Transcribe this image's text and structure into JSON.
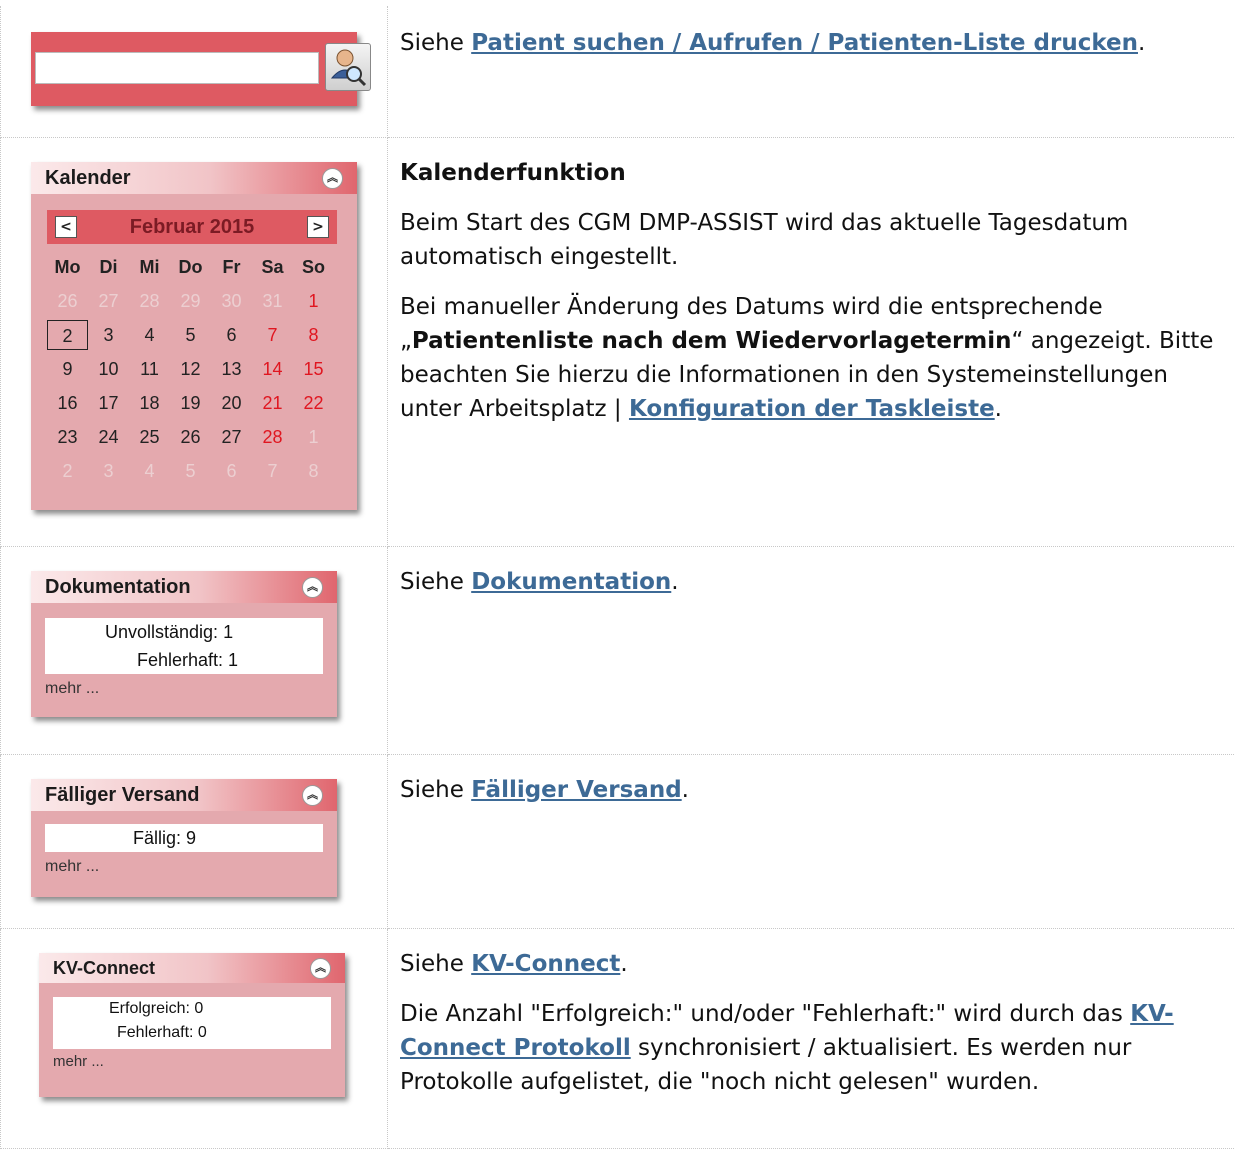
{
  "rows": [
    {
      "widget": "search",
      "icon": "user-search-icon",
      "text": {
        "prefix": "Siehe ",
        "link": "Patient suchen / Aufrufen / Patienten-Liste drucken",
        "suffix": "."
      }
    },
    {
      "widget": "calendar",
      "title": "Kalenderfunktion",
      "para1": "Beim Start des CGM DMP-ASSIST wird das aktuelle Tagesdatum automatisch eingestellt.",
      "para2_a": "Bei manueller Änderung des Datums wird die entsprechende „",
      "para2_bold": "Patientenliste nach dem Wiedervorlagetermin",
      "para2_b": "“ angezeigt. Bitte beachten Sie hierzu die Informationen in den Systemeinstellungen unter Arbeitsplatz | ",
      "para2_link": "Konfiguration der Taskleiste",
      "para2_end": "."
    },
    {
      "widget": "dokumentation",
      "text": {
        "prefix": "Siehe ",
        "link": "Dokumentation",
        "suffix": "."
      }
    },
    {
      "widget": "versand",
      "text": {
        "prefix": "Siehe ",
        "link": "Fälliger Versand",
        "suffix": "."
      }
    },
    {
      "widget": "kvconnect",
      "text": {
        "prefix": "Siehe ",
        "link": "KV-Connect",
        "suffix": "."
      },
      "para2_a": "Die Anzahl \"Erfolgreich:\" und/oder \"Fehlerhaft:\" wird durch das ",
      "para2_link": "KV-Connect Protokoll",
      "para2_b": " synchronisiert / aktualisiert. Es werden nur Protokolle aufgelistet, die \"noch nicht gelesen\" wurden."
    }
  ],
  "calendar": {
    "header": "Kalender",
    "month": "Februar 2015",
    "prev": "<",
    "next": ">",
    "weekdays": [
      "Mo",
      "Di",
      "Mi",
      "Do",
      "Fr",
      "Sa",
      "So"
    ],
    "weeks": [
      [
        "26",
        "27",
        "28",
        "29",
        "30",
        "31",
        "1"
      ],
      [
        "2",
        "3",
        "4",
        "5",
        "6",
        "7",
        "8"
      ],
      [
        "9",
        "10",
        "11",
        "12",
        "13",
        "14",
        "15"
      ],
      [
        "16",
        "17",
        "18",
        "19",
        "20",
        "21",
        "22"
      ],
      [
        "23",
        "24",
        "25",
        "26",
        "27",
        "28",
        "1"
      ],
      [
        "2",
        "3",
        "4",
        "5",
        "6",
        "7",
        "8"
      ]
    ],
    "today": "2"
  },
  "dokumentation": {
    "header": "Dokumentation",
    "line1": "Unvollständig: 1",
    "line2": "Fehlerhaft: 1",
    "more": "mehr ..."
  },
  "versand": {
    "header": "Fälliger Versand",
    "line1": "Fällig: 9",
    "more": "mehr ..."
  },
  "kvconnect": {
    "header": "KV-Connect",
    "line1": "Erfolgreich: 0",
    "line2": "Fehlerhaft: 0",
    "more": "mehr ..."
  },
  "colors": {
    "widget_red": "#de5a62",
    "panel_bg": "#e4a9ae",
    "link": "#3d6a96",
    "weekend": "#e01620"
  }
}
